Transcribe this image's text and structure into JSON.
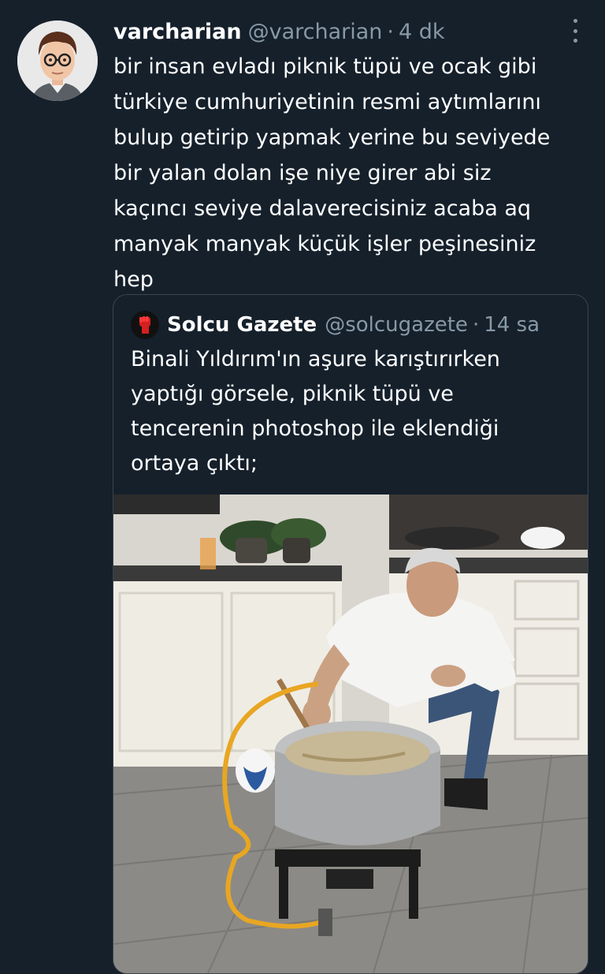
{
  "tweet": {
    "display_name": "varcharian",
    "handle": "@varcharian",
    "separator": "·",
    "time": "4 dk",
    "lines": [
      "bir insan evladı piknik tüpü ve ocak gibi",
      "türkiye cumhuriyetinin resmi aytımlarını",
      "bulup getirip yapmak yerine bu seviyede",
      "bir yalan dolan işe niye girer abi siz",
      "kaçıncı seviye dalaverecisiniz acaba aq",
      "manyak manyak küçük işler peşinesiniz",
      "hep"
    ]
  },
  "quote": {
    "display_name": "Solcu Gazete",
    "handle": "@solcugazete",
    "separator": "·",
    "time": "14 sa",
    "lines": [
      "Binali Yıldırım'ın aşure karıştırırken",
      "yaptığı görsele, piknik tüpü ve",
      "tencerenin photoshop ile eklendiği",
      "ortaya çıktı;"
    ]
  },
  "icons": {
    "more": "more-vertical-icon",
    "quote_logo": "fist-logo-icon"
  },
  "colors": {
    "background": "#15202b",
    "secondary_text": "#8899a6",
    "border": "#38444d",
    "logo_red": "#d42020"
  }
}
